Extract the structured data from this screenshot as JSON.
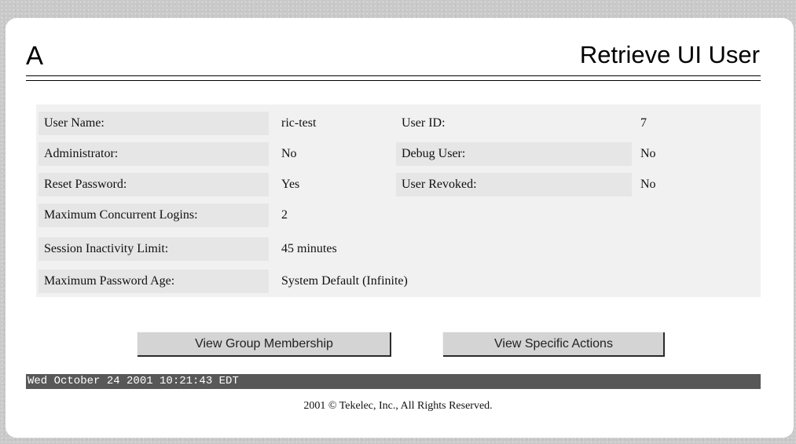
{
  "header": {
    "logo": "A",
    "title": "Retrieve UI User"
  },
  "fields": {
    "user_name": {
      "label": "User Name:",
      "value": "ric-test"
    },
    "user_id": {
      "label": "User ID:",
      "value": "7"
    },
    "administrator": {
      "label": "Administrator:",
      "value": "No"
    },
    "debug_user": {
      "label": "Debug User:",
      "value": "No"
    },
    "reset_password": {
      "label": "Reset Password:",
      "value": "Yes"
    },
    "user_revoked": {
      "label": "User Revoked:",
      "value": "No"
    },
    "max_logins": {
      "label": "Maximum Concurrent Logins:",
      "value": "2"
    },
    "inactivity": {
      "label": "Session Inactivity Limit:",
      "value": "45 minutes"
    },
    "password_age": {
      "label": "Maximum Password Age:",
      "value": "System Default (Infinite)"
    }
  },
  "buttons": {
    "group_membership": "View Group Membership",
    "specific_actions": "View Specific Actions"
  },
  "status_bar": {
    "timestamp": "Wed October 24 2001 10:21:43 EDT"
  },
  "footer": {
    "copyright": "2001 © Tekelec, Inc., All Rights Reserved."
  }
}
